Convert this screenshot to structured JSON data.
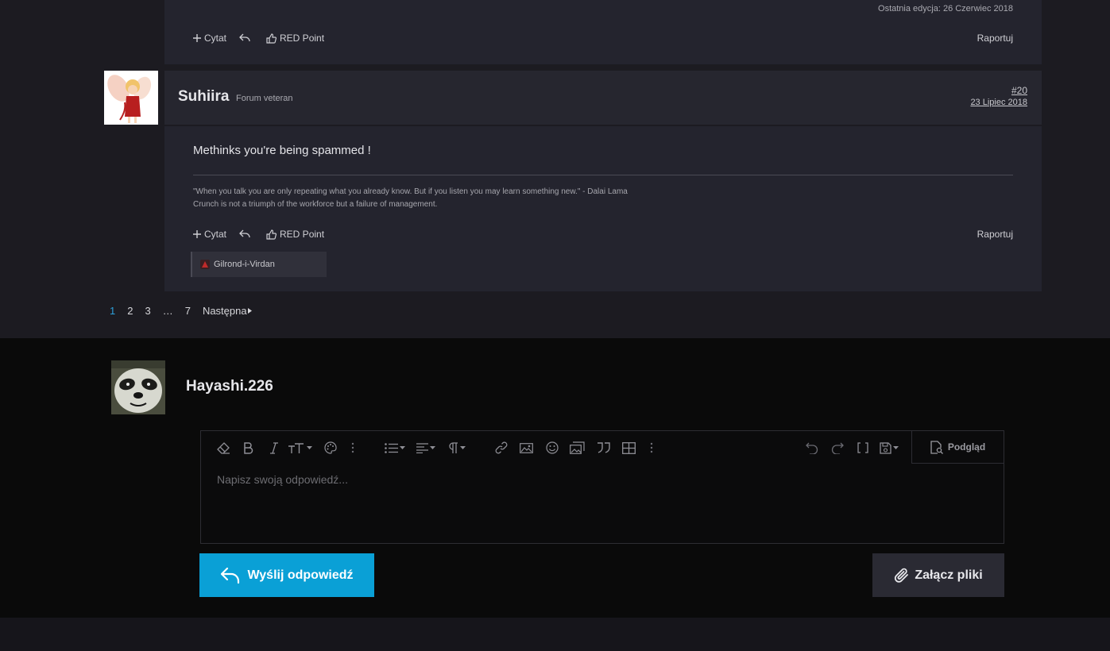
{
  "previous_post": {
    "edit_note": "Ostatnia edycja: 26 Czerwiec 2018",
    "actions": {
      "quote": "Cytat",
      "red_point": "RED Point",
      "report": "Raportuj"
    }
  },
  "post": {
    "username": "Suhiira",
    "rank": "Forum veteran",
    "number": "#20",
    "date": "23 Lipiec 2018",
    "text": "Methinks you're being spammed !",
    "signature": [
      "\"When you talk you are only repeating what you already know. But if you listen you may learn something new.\" - Dalai Lama",
      "Crunch is not a triumph of the workforce but a failure of management."
    ],
    "actions": {
      "quote": "Cytat",
      "red_point": "RED Point",
      "report": "Raportuj"
    },
    "reactions": [
      "Gilrond-i-Virdan"
    ]
  },
  "pagination": {
    "pages": [
      "1",
      "2",
      "3",
      "…",
      "7"
    ],
    "current": "1",
    "next": "Następna"
  },
  "reply": {
    "username": "Hayashi.226",
    "placeholder": "Napisz swoją odpowiedź...",
    "preview": "Podgląd",
    "send": "Wyślij odpowiedź",
    "attach": "Załącz pliki",
    "toolbar_icons": [
      "eraser-icon",
      "bold-icon",
      "italic-icon",
      "text-size-icon",
      "palette-icon",
      "more-icon",
      "list-icon",
      "align-icon",
      "paragraph-icon",
      "link-icon",
      "image-icon",
      "emoji-icon",
      "media-icon",
      "quote-icon",
      "table-icon",
      "more-icon",
      "undo-icon",
      "redo-icon",
      "brackets-icon",
      "save-draft-icon"
    ]
  },
  "colors": {
    "accent": "#0aa0d6",
    "page_number_current": "#2d9fd9",
    "post_bg": "#24242e",
    "reply_bg": "#0a0a0a"
  }
}
